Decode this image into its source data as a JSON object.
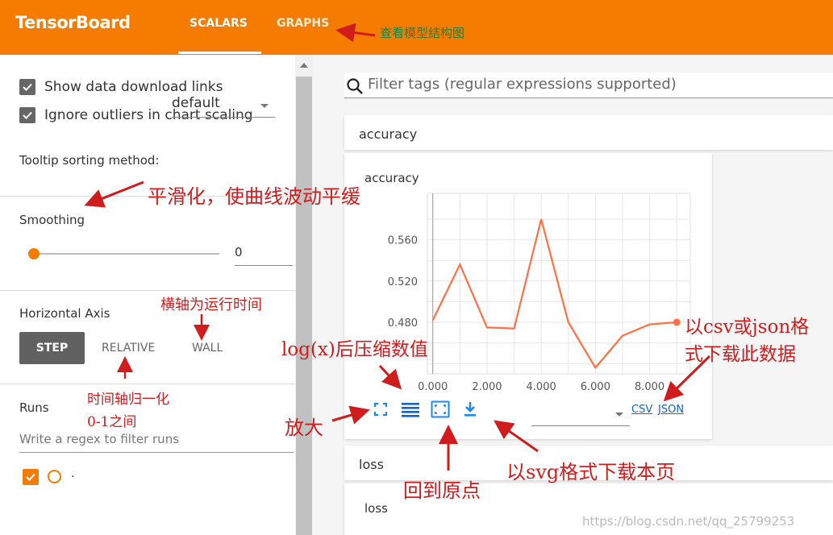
{
  "header": {
    "brand": "TensorBoard",
    "tabs": [
      {
        "label": "SCALARS",
        "active": true
      },
      {
        "label": "GRAPHS",
        "active": false
      }
    ],
    "annotation": "查看模型结构图"
  },
  "sidebar": {
    "show_download_links": {
      "label": "Show data download links",
      "checked": true
    },
    "ignore_outliers": {
      "label": "Ignore outliers in chart scaling",
      "checked": true
    },
    "tooltip_sorting": {
      "label": "Tooltip sorting method:",
      "value": "default"
    },
    "smoothing": {
      "label": "Smoothing",
      "value": "0",
      "slider_fraction": 0
    },
    "horizontal_axis": {
      "label": "Horizontal Axis",
      "options": [
        "STEP",
        "RELATIVE",
        "WALL"
      ],
      "selected": "STEP"
    },
    "runs": {
      "label": "Runs",
      "filter_placeholder": "Write a regex to filter runs",
      "items": [
        {
          "name": ".",
          "checked": true
        }
      ]
    }
  },
  "main": {
    "filter_placeholder": "Filter tags (regular expressions supported)",
    "cards": [
      {
        "title": "accuracy"
      },
      {
        "title": "loss"
      }
    ],
    "links": {
      "csv": "CSV",
      "json": "JSON"
    }
  },
  "chart_data": [
    {
      "type": "line",
      "title": "accuracy",
      "x": [
        0,
        1,
        2,
        3,
        4,
        5,
        6,
        7,
        8,
        9
      ],
      "series": [
        {
          "values": [
            0.482,
            0.536,
            0.475,
            0.474,
            0.58,
            0.48,
            0.436,
            0.467,
            0.478,
            0.48
          ]
        }
      ],
      "xticks": [
        "0.000",
        "2.000",
        "4.000",
        "6.000",
        "8.000"
      ],
      "yticks": [
        "0.480",
        "0.520",
        "0.560"
      ],
      "xlim": [
        -0.2,
        9.5
      ],
      "ylim": [
        0.43,
        0.605
      ],
      "grid": true,
      "line_color": "#ff7043"
    }
  ],
  "chart_loss": {
    "title": "loss"
  },
  "annotations": {
    "smoothing": "平滑化，使曲线波动平缓",
    "wall": "横轴为运行时间",
    "relative_l1": "时间轴归一化",
    "relative_l2": "0-1之间",
    "log": "log(x)后压缩数值",
    "csv_l1": "以csv或json格",
    "csv_l2": "式下载此数据",
    "zoom": "放大",
    "origin": "回到原点",
    "svg": "以svg格式下载本页"
  },
  "watermark": "https://blog.csdn.net/qq_25799253",
  "icons": [
    "check-icon",
    "search-icon",
    "fullscreen-icon",
    "log-scale-icon",
    "fit-domain-icon",
    "download-icon",
    "chevron-down-icon"
  ]
}
